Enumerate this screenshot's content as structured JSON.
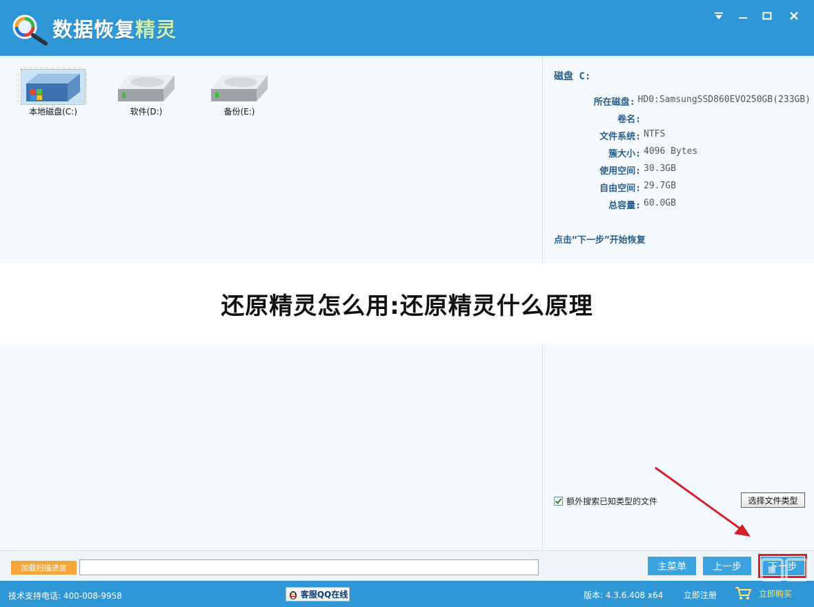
{
  "app": {
    "title_main": "数据恢复",
    "title_accent": "精灵"
  },
  "window_controls": {
    "menu_icon": "dropdown-menu-icon",
    "minimize_icon": "minimize-icon",
    "maximize_icon": "maximize-icon",
    "close_icon": "close-icon"
  },
  "drives": [
    {
      "label": "本地磁盘(C:)",
      "icon": "system-drive-icon",
      "selected": true
    },
    {
      "label": "软件(D:)",
      "icon": "hard-drive-icon",
      "selected": false
    },
    {
      "label": "备份(E:)",
      "icon": "hard-drive-icon",
      "selected": false
    }
  ],
  "disk_info": {
    "title": "磁盘 C:",
    "rows": [
      {
        "key": "所在磁盘:",
        "value": "HD0:SamsungSSD860EVO250GB(233GB)"
      },
      {
        "key": "卷名:",
        "value": ""
      },
      {
        "key": "文件系统:",
        "value": "NTFS"
      },
      {
        "key": "簇大小:",
        "value": "4096 Bytes"
      },
      {
        "key": "使用空间:",
        "value": "30.3GB"
      },
      {
        "key": "自由空间:",
        "value": "29.7GB"
      },
      {
        "key": "总容量:",
        "value": "60.0GB"
      }
    ],
    "hint": "点击“下一步”开始恢复"
  },
  "options": {
    "extra_search_label": "额外搜索已知类型的文件",
    "extra_search_checked": true,
    "choose_filetype_label": "选择文件类型"
  },
  "banner": {
    "text": "还原精灵怎么用:还原精灵什么原理"
  },
  "toolbar": {
    "load_progress_label": "加载扫描进度",
    "progress_value": "",
    "main_menu_label": "主菜单",
    "prev_label": "上一步",
    "next_label": "下一步"
  },
  "status": {
    "phone": "技术支持电话: 400-008-9958",
    "qq_label": "客服QQ在线",
    "version": "版本: 4.3.6.408 x64",
    "register": "立即注册",
    "buy": "立即购买"
  },
  "colors": {
    "titlebar": "#2f97d6",
    "button": "#3aa3e0",
    "highlight_box": "#d3202a",
    "arrow": "#d3202a",
    "orange_button": "#f6a63a"
  }
}
